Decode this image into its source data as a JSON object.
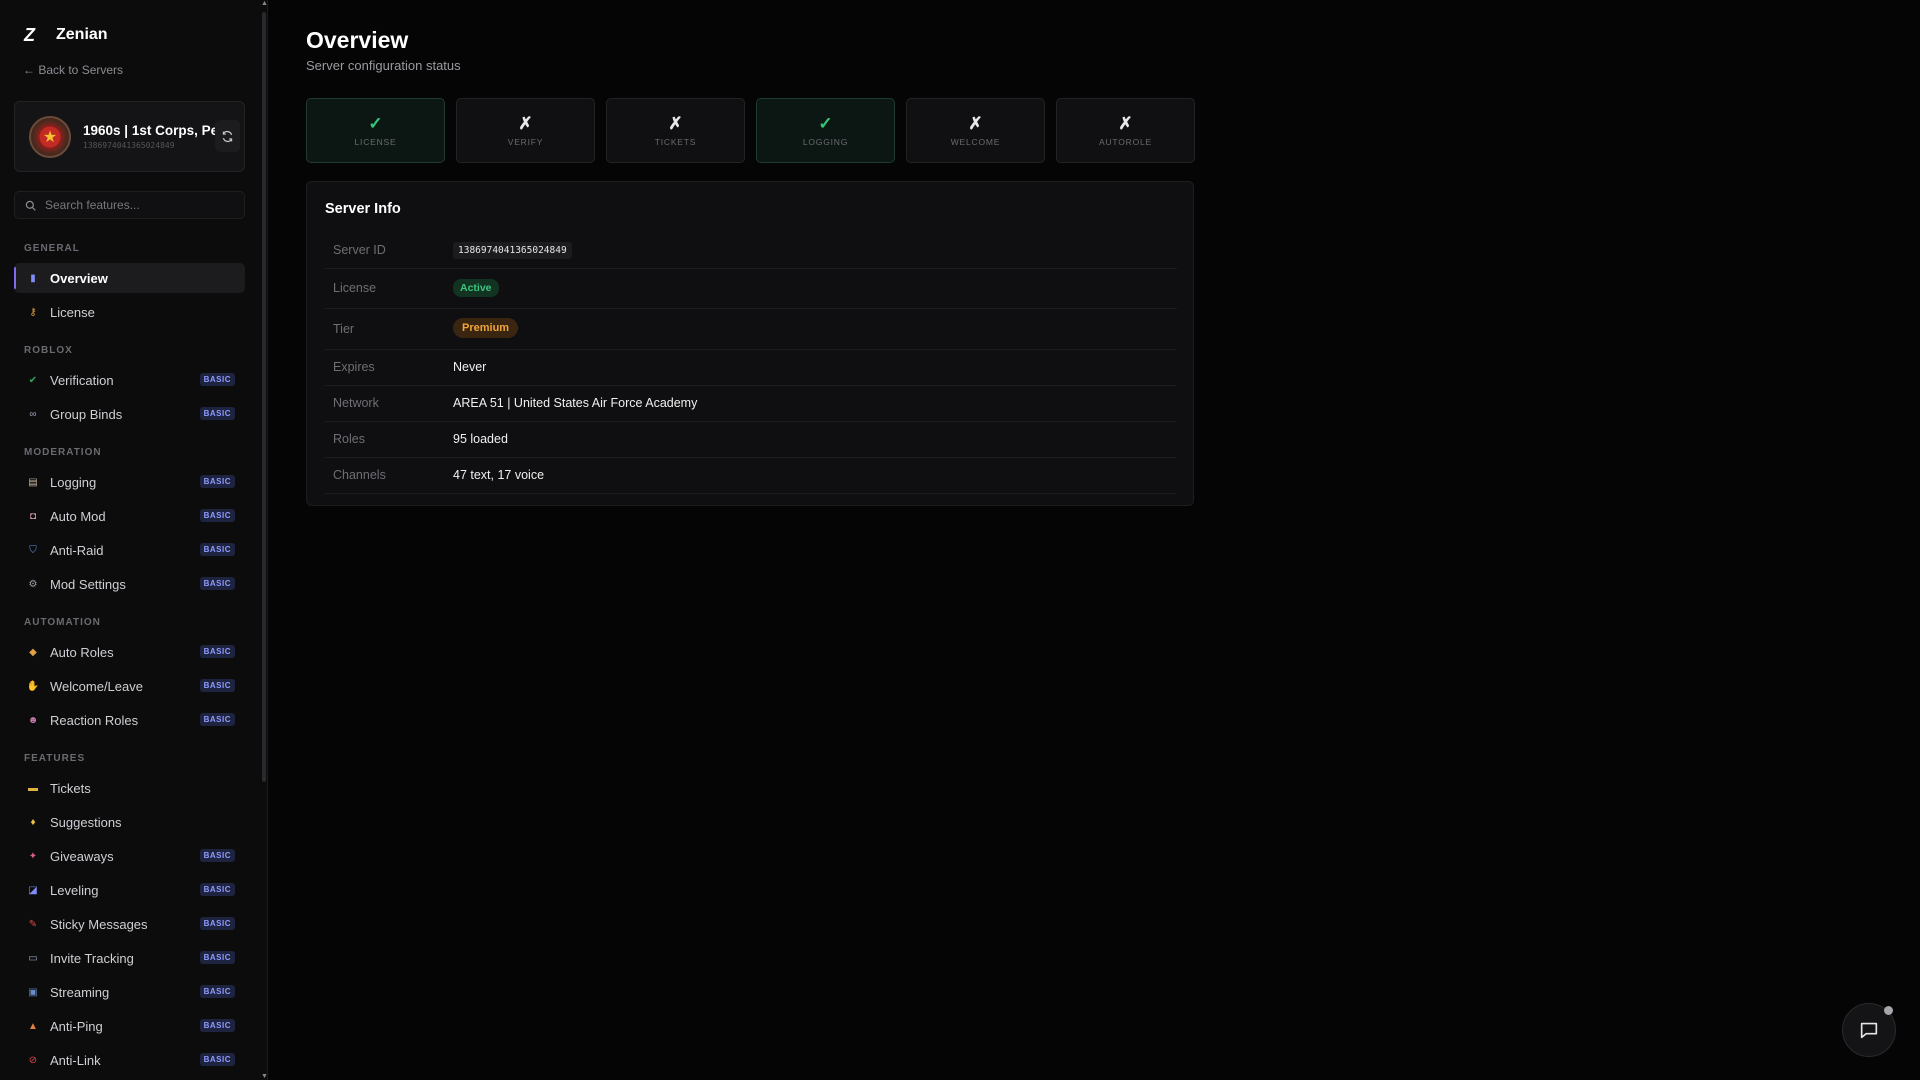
{
  "brand": {
    "logo": "Z",
    "name": "Zenian"
  },
  "back_link": "← Back to Servers",
  "server": {
    "name": "1960s | 1st Corps, Pe...",
    "id": "1386974041365024849"
  },
  "search": {
    "placeholder": "Search features..."
  },
  "sidebar": {
    "sections": [
      {
        "title": "GENERAL"
      },
      {
        "title": "ROBLOX"
      },
      {
        "title": "MODERATION"
      },
      {
        "title": "AUTOMATION"
      },
      {
        "title": "FEATURES"
      }
    ],
    "items": [
      {
        "label": "Overview",
        "icon": "bar-chart-icon",
        "color": "#7e8cf5",
        "badge": ""
      },
      {
        "label": "License",
        "icon": "key-icon",
        "color": "#e0a340",
        "badge": ""
      },
      {
        "label": "Verification",
        "icon": "check-box-icon",
        "color": "#2fa55a",
        "badge": "BASIC"
      },
      {
        "label": "Group Binds",
        "icon": "link-icon",
        "color": "#9aa4b8",
        "badge": "BASIC"
      },
      {
        "label": "Logging",
        "icon": "log-icon",
        "color": "#c9b8a0",
        "badge": "BASIC"
      },
      {
        "label": "Auto Mod",
        "icon": "robot-icon",
        "color": "#d4a0b0",
        "badge": "BASIC"
      },
      {
        "label": "Anti-Raid",
        "icon": "shield-icon",
        "color": "#5b8fd8",
        "badge": "BASIC"
      },
      {
        "label": "Mod Settings",
        "icon": "gear-icon",
        "color": "#9aa0aa",
        "badge": "BASIC"
      },
      {
        "label": "Auto Roles",
        "icon": "tag-icon",
        "color": "#e0a340",
        "badge": "BASIC"
      },
      {
        "label": "Welcome/Leave",
        "icon": "wave-icon",
        "color": "#f0c040",
        "badge": "BASIC"
      },
      {
        "label": "Reaction Roles",
        "icon": "masks-icon",
        "color": "#c07ab0",
        "badge": "BASIC"
      },
      {
        "label": "Tickets",
        "icon": "ticket-icon",
        "color": "#e0b040",
        "badge": ""
      },
      {
        "label": "Suggestions",
        "icon": "bulb-icon",
        "color": "#f0c040",
        "badge": ""
      },
      {
        "label": "Giveaways",
        "icon": "party-icon",
        "color": "#d86080",
        "badge": "BASIC"
      },
      {
        "label": "Leveling",
        "icon": "trend-chart-icon",
        "color": "#7e8cf5",
        "badge": "BASIC"
      },
      {
        "label": "Sticky Messages",
        "icon": "pin-icon",
        "color": "#e04848",
        "badge": "BASIC"
      },
      {
        "label": "Invite Tracking",
        "icon": "inbox-icon",
        "color": "#9aa8c0",
        "badge": "BASIC"
      },
      {
        "label": "Streaming",
        "icon": "tv-icon",
        "color": "#6a8cc8",
        "badge": "BASIC"
      },
      {
        "label": "Anti-Ping",
        "icon": "bell-icon",
        "color": "#e08040",
        "badge": "BASIC"
      },
      {
        "label": "Anti-Link",
        "icon": "no-entry-icon",
        "color": "#e04848",
        "badge": "BASIC"
      }
    ]
  },
  "main": {
    "title": "Overview",
    "subtitle": "Server configuration status",
    "status_cards": [
      {
        "label": "LICENSE",
        "mark": "✓",
        "ok": true
      },
      {
        "label": "VERIFY",
        "mark": "✗",
        "ok": false
      },
      {
        "label": "TICKETS",
        "mark": "✗",
        "ok": false
      },
      {
        "label": "LOGGING",
        "mark": "✓",
        "ok": true
      },
      {
        "label": "WELCOME",
        "mark": "✗",
        "ok": false
      },
      {
        "label": "AUTOROLE",
        "mark": "✗",
        "ok": false
      }
    ],
    "server_info": {
      "title": "Server Info",
      "rows": [
        {
          "key": "Server ID",
          "value": "1386974041365024849"
        },
        {
          "key": "License",
          "value": "Active"
        },
        {
          "key": "Tier",
          "value": "Premium"
        },
        {
          "key": "Expires",
          "value": "Never"
        },
        {
          "key": "Network",
          "value": "AREA 51 | United States Air Force Academy"
        },
        {
          "key": "Roles",
          "value": "95 loaded"
        },
        {
          "key": "Channels",
          "value": "47 text, 17 voice"
        }
      ]
    }
  }
}
